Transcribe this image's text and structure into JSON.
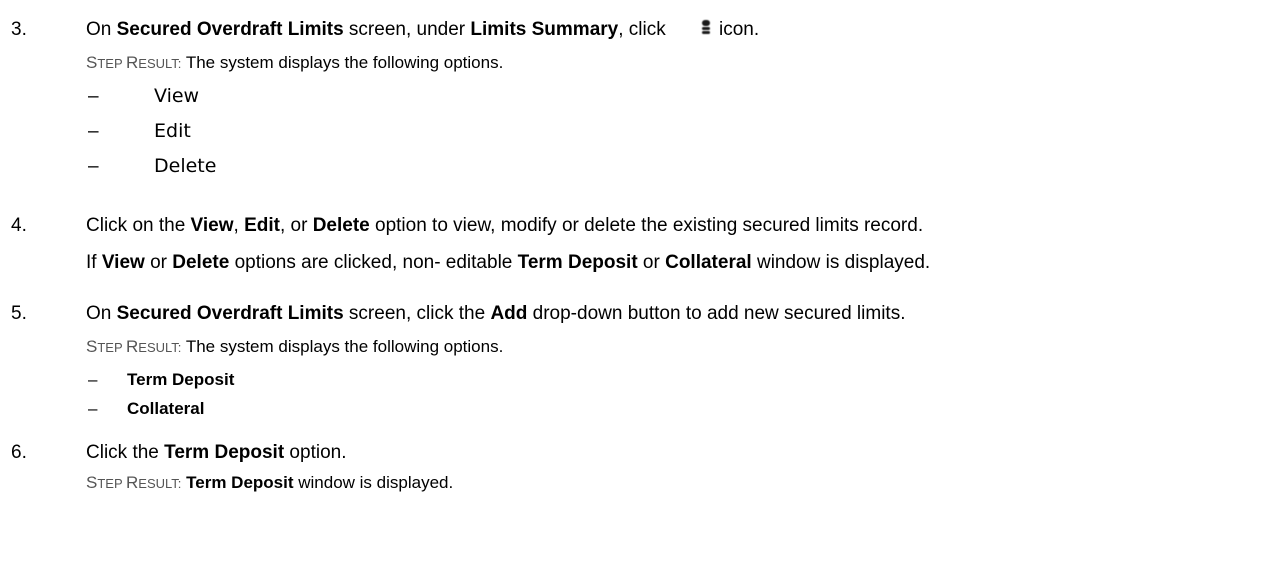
{
  "step3": {
    "num": "3.",
    "pre1": "On ",
    "screen": "Secured Overdraft Limits",
    "pre2": " screen, under ",
    "section": "Limits Summary",
    "pre3": ", click",
    "icon_name": "kebab-menu-icon",
    "post": " icon.",
    "result_s": "S",
    "result_tep": "TEP ",
    "result_r": "R",
    "result_esult": "ESULT:",
    "result_text": " The system displays the following options.",
    "options": [
      {
        "dash": "–",
        "label": "View"
      },
      {
        "dash": "–",
        "label": "Edit"
      },
      {
        "dash": "–",
        "label": "Delete"
      }
    ]
  },
  "step4": {
    "num": "4.",
    "pre1": "Click on the ",
    "view": "View",
    "sep1": ", ",
    "edit": "Edit",
    "sep2": ", or ",
    "delete": "Delete",
    "post": " option to view, modify or delete the existing secured limits record.",
    "l2_pre": "If ",
    "l2_view": "View",
    "l2_or": " or ",
    "l2_delete": "Delete",
    "l2_mid": " options are clicked, non- editable ",
    "l2_td": "Term Deposit",
    "l2_or2": " or ",
    "l2_col": "Collateral",
    "l2_post": " window is displayed."
  },
  "step5": {
    "num": "5.",
    "pre1": "On ",
    "screen": "Secured Overdraft Limits",
    "pre2": " screen, click the ",
    "add": "Add",
    "post": " drop-down button to add new secured limits.",
    "result_s": "S",
    "result_tep": "TEP ",
    "result_r": "R",
    "result_esult": "ESULT:",
    "result_text": " The system displays the following options.",
    "options": [
      {
        "dash": "–",
        "label": "Term Deposit"
      },
      {
        "dash": "–",
        "label": "Collateral"
      }
    ]
  },
  "step6": {
    "num": "6.",
    "pre1": "Click the ",
    "td": "Term Deposit",
    "post": " option.",
    "result_s": "S",
    "result_tep": "TEP ",
    "result_r": "R",
    "result_esult": "ESULT:",
    "result_sp": " ",
    "result_bold": "Term Deposit",
    "result_text": " window is displayed."
  }
}
